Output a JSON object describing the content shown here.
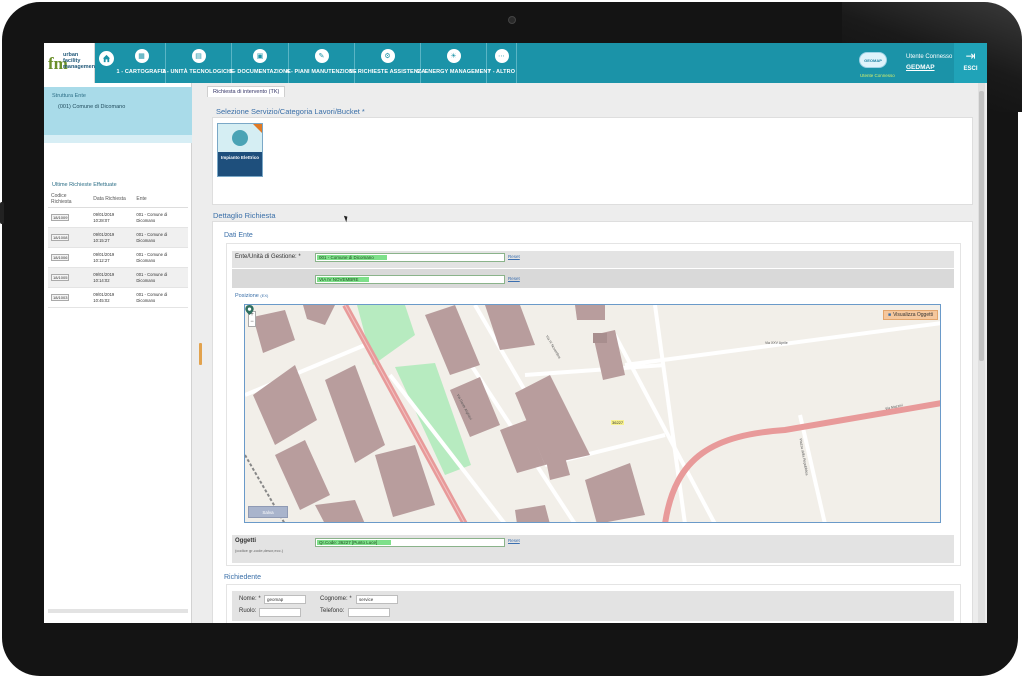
{
  "app": {
    "logo": {
      "mark": "fm",
      "lines": [
        "urban",
        "facility",
        "management"
      ]
    }
  },
  "nav": {
    "items": [
      {
        "label": "1 - CARTOGRAFIA",
        "icon": "map-icon"
      },
      {
        "label": "2 - UNITÀ TECNOLOGICHE",
        "icon": "building-icon"
      },
      {
        "label": "3 - DOCUMENTAZIONE",
        "icon": "document-icon"
      },
      {
        "label": "4 - PIANI MANUTENZIONE",
        "icon": "wrench-icon"
      },
      {
        "label": "5 - RICHIESTE ASSISTENZA",
        "icon": "support-icon"
      },
      {
        "label": "6 - ENERGY MANAGEMENT",
        "icon": "energy-icon"
      },
      {
        "label": "7 - ALTRO",
        "icon": "more-icon"
      }
    ],
    "badge": "GEOMAP",
    "user_role": "Utente Connesso",
    "user_label": "Utente Connesso",
    "user_name": "GEDMAP",
    "exit_label": "ESCI"
  },
  "sidebar": {
    "structure_title": "Struttura Ente",
    "structure_value": "(001) Comune di Dicomano",
    "requests_title": "Ultime Richieste Effettuate",
    "columns": [
      "Codice Richiesta",
      "Data Richiesta",
      "Ente"
    ],
    "rows": [
      {
        "code": "18/1009",
        "date": "09/01/2019 10:28:07",
        "ente": "001 - Comune di Dicomano"
      },
      {
        "code": "18/1008",
        "date": "09/01/2019 10:15:27",
        "ente": "001 - Comune di Dicomano"
      },
      {
        "code": "18/1006",
        "date": "09/01/2019 10:12:27",
        "ente": "001 - Comune di Dicomano"
      },
      {
        "code": "18/1005",
        "date": "09/01/2019 10:14:02",
        "ente": "001 - Comune di Dicomano"
      },
      {
        "code": "18/1003",
        "date": "09/01/2019 10:45:02",
        "ente": "001 - Comune di Dicomano"
      }
    ]
  },
  "main": {
    "tab": "Richiesta di intervento (TK)",
    "service_title": "Selezione Servizio/Categoria Lavori/Bucket *",
    "tile_label": "Impianto Elettrico",
    "detail_title": "Dettaglio Richiesta",
    "dati_ente_title": "Dati Ente",
    "ente_label": "Ente/Unità di Gestione: *",
    "ente_value": "001 - Comune di Dicomano",
    "street_value": "VIA IV NOVEMBRE",
    "reset_label": "Reset",
    "posizione_label": "Posizione",
    "posizione_hint": "(EX)",
    "map": {
      "visualizza_label": "Visualizza Oggetti",
      "button_label": "Salva",
      "marker_label": "36227",
      "zoom_in": "+",
      "zoom_out": "−",
      "streets": [
        "Via XXV Aprile",
        "Via IV Novembre",
        "Via Dante Alighieri",
        "Piazza della Repubblica",
        "Via Mazzini"
      ]
    },
    "oggetti_label": "Oggetti",
    "oggetti_hint": "(codice gr-code,descr,ecc.)",
    "oggetti_value": "Qr.Code: 36227 [Punto Luce]",
    "richiedente_title": "Richiedente",
    "nome_label": "Nome: *",
    "nome_value": "geomap",
    "cognome_label": "Cognome: *",
    "cognome_value": "service",
    "ruolo_label": "Ruolo:",
    "telefono_label": "Telefono:"
  },
  "colors": {
    "topbar": "#1b93a8",
    "accent": "#3a6fa8",
    "field_fill": "#7ee08a",
    "road": "#e89a9a",
    "building": "#b89d9d",
    "park": "#b7ebc0"
  }
}
